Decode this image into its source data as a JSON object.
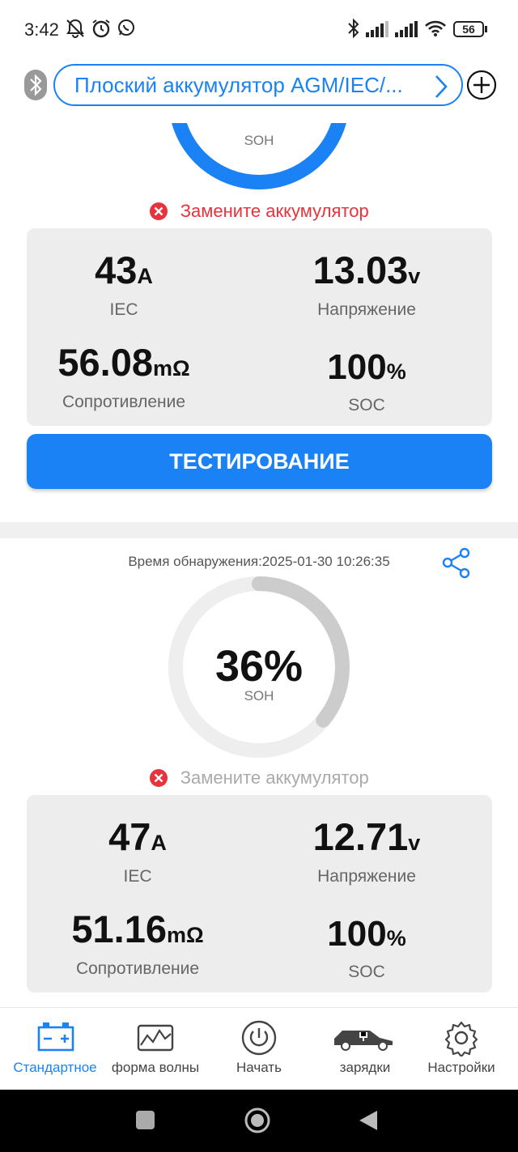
{
  "status_bar": {
    "time": "3:42",
    "battery": "56",
    "icons": [
      "bell-off-icon",
      "alarm-icon",
      "whatsapp-icon",
      "bluetooth-icon",
      "signal-icon",
      "signal-icon",
      "wifi-icon",
      "battery-icon"
    ]
  },
  "header": {
    "device_name": "Плоский аккумулятор AGM/IEC/...",
    "icons": [
      "bluetooth-icon",
      "chevron-right-icon",
      "add-icon"
    ]
  },
  "result1": {
    "soh_label": "SOH",
    "soh_fraction": 0.9,
    "status": "Замените аккумулятор",
    "iec_value": "43",
    "iec_unit": "A",
    "iec_label": "IEC",
    "voltage_value": "13.03",
    "voltage_unit": "v",
    "voltage_label": "Напряжение",
    "resistance_value": "56.08",
    "resistance_unit": "mΩ",
    "resistance_label": "Сопротивление",
    "soc_value": "100",
    "soc_unit": "%",
    "soc_label": "SOC"
  },
  "test_button": "ТЕСТИРОВАНИЕ",
  "result2": {
    "detection_time": "Время обнаружения:2025-01-30 10:26:35",
    "soh_value": "36%",
    "soh_label": "SOH",
    "soh_fraction": 0.36,
    "status": "Замените аккумулятор",
    "iec_value": "47",
    "iec_unit": "A",
    "iec_label": "IEC",
    "voltage_value": "12.71",
    "voltage_unit": "v",
    "voltage_label": "Напряжение",
    "resistance_value": "51.16",
    "resistance_unit": "mΩ",
    "resistance_label": "Сопротивление",
    "soc_value": "100",
    "soc_unit": "%",
    "soc_label": "SOC"
  },
  "bottom_nav": [
    {
      "label": "Стандартное",
      "icon": "battery-icon",
      "active": true
    },
    {
      "label": "форма волны",
      "icon": "waveform-icon",
      "active": false
    },
    {
      "label": "Начать",
      "icon": "power-icon",
      "active": false
    },
    {
      "label": "зарядки",
      "icon": "car-charging-icon",
      "active": false
    },
    {
      "label": "Настройки",
      "icon": "gear-icon",
      "active": false
    }
  ],
  "colors": {
    "accent": "#1a82f5",
    "danger": "#e8323c",
    "panel": "#ededed",
    "gauge_track": "#eeeeee",
    "gauge_gray": "#cccccc"
  }
}
